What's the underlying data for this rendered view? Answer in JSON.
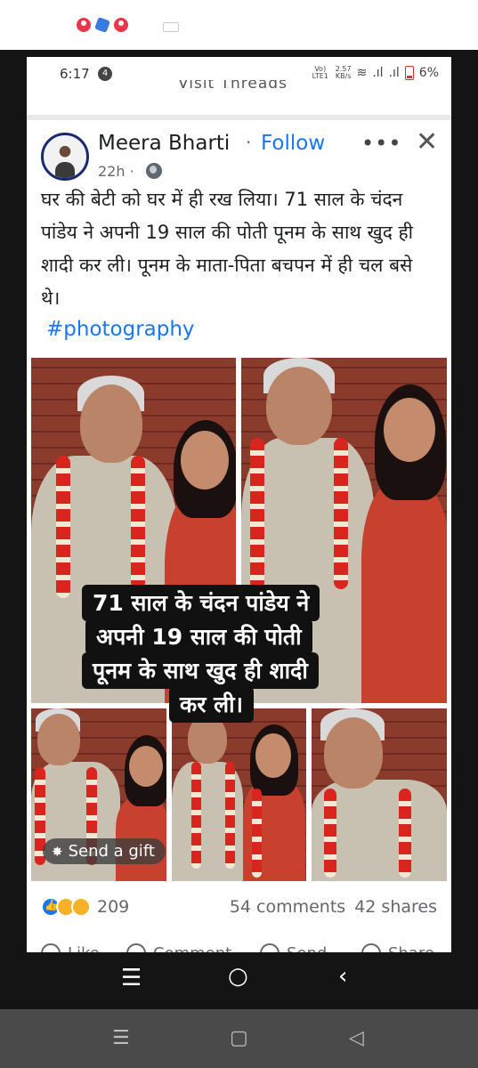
{
  "status_bar": {
    "time": "6:17",
    "notification_count": "4",
    "network_label": "Vo) LTE1",
    "speed_value": "2.57",
    "speed_unit": "KB/s",
    "battery": "6%"
  },
  "page": {
    "cut_title": "Visit Threads"
  },
  "post": {
    "author": "Meera Bharti",
    "separator": "·",
    "follow_label": "Follow",
    "time_ago": "22h ·",
    "more_label": "•••",
    "close_label": "✕",
    "text": "घर की बेटी को घर में ही रख लिया। 71 साल के चंदन पांडेय ने अपनी 19 साल की पोती पूनम के साथ खुद ही शादी कर ली। पूनम के माता-पिता बचपन में ही चल बसे थे।",
    "hashtag": "#photography",
    "image_caption_lines": [
      "71 साल के चंदन पांडेय ने",
      "अपनी 19 साल की पोती",
      "पूनम के साथ खुद ही शादी",
      "कर ली।"
    ],
    "send_gift_label": "Send a gift",
    "reaction_count": "209",
    "comments": "54 comments",
    "shares": "42 shares",
    "actions": [
      "Like",
      "Comment",
      "Send",
      "Share"
    ]
  },
  "colors": {
    "link_blue": "#1877f2",
    "text_dark": "#1c1e21",
    "text_muted": "#65676b"
  }
}
